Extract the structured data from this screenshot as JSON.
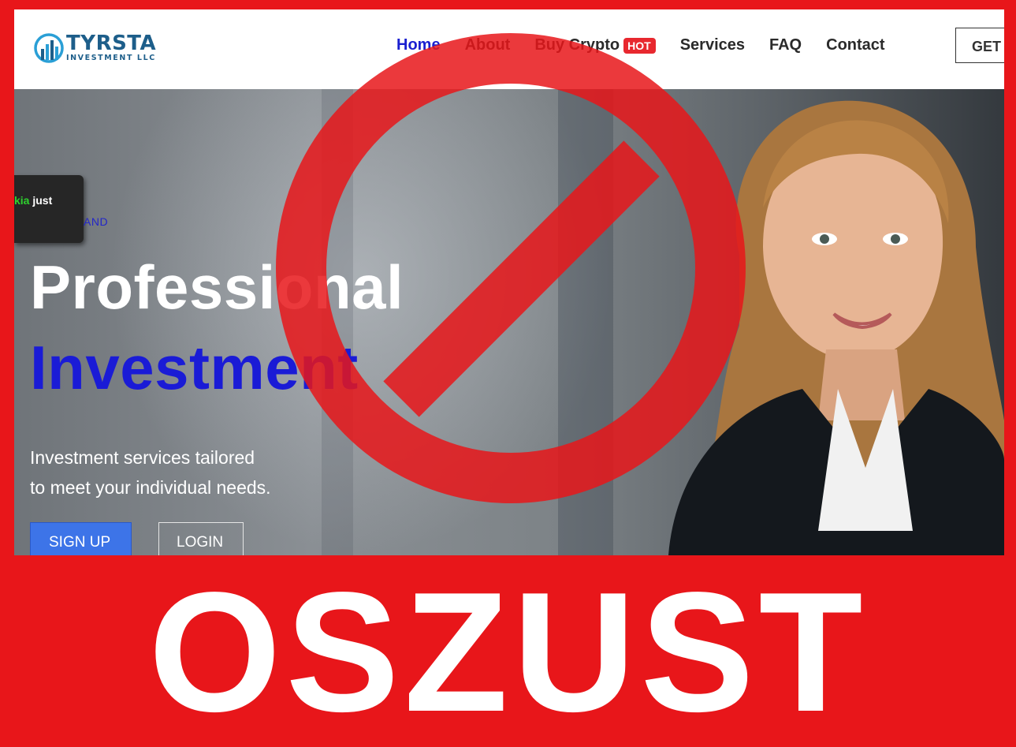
{
  "brand": {
    "name": "TYRSTA",
    "subtitle": "INVESTMENT LLC"
  },
  "nav": {
    "items": [
      {
        "label": "Home",
        "active": true
      },
      {
        "label": "About"
      },
      {
        "label": "Buy Crypto",
        "badge": "HOT"
      },
      {
        "label": "Services"
      },
      {
        "label": "FAQ"
      },
      {
        "label": "Contact"
      }
    ],
    "cta_label": "GET S"
  },
  "toast": {
    "name": "kia",
    "action": "just"
  },
  "hero": {
    "tagline": "AND",
    "headline_line1": "Professional",
    "headline_line2": "Investment",
    "description_line1": "Investment services tailored",
    "description_line2": "to meet your individual needs.",
    "signup_label": "SIGN UP",
    "login_label": "LOGIN"
  },
  "overlay": {
    "warning_text": "OSZUST",
    "ban_color": "#e8161a",
    "background_color": "#e8161a"
  },
  "colors": {
    "accent_blue": "#1a1fd0",
    "brand_teal": "#1d5e8a",
    "hot_badge": "#e8282f",
    "signup_button": "#3d74e8",
    "toast_highlight": "#2ed12e"
  },
  "icons": [
    "logo-globe-icon",
    "ban-sign-icon"
  ]
}
